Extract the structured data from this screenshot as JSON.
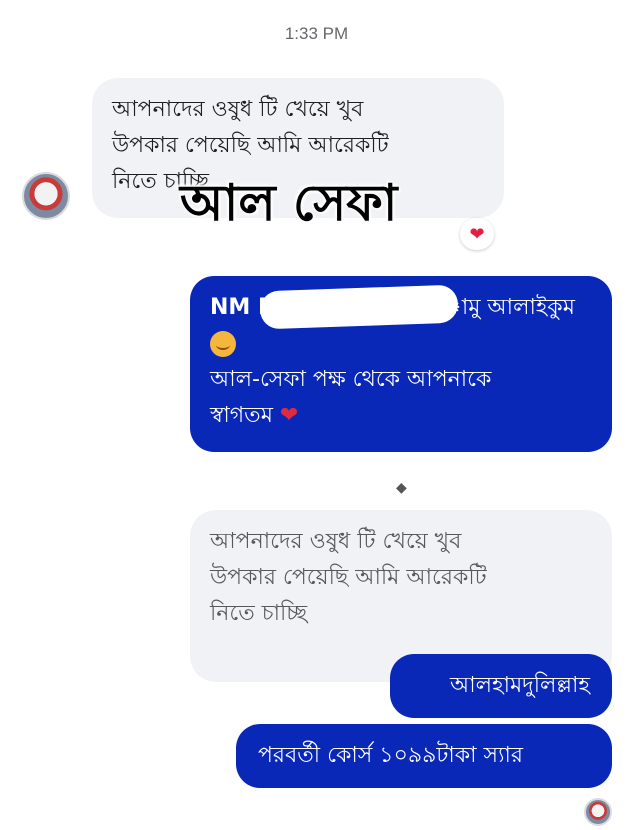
{
  "header": {
    "timestamp": "1:33 PM"
  },
  "messages": {
    "incoming_1": {
      "lines": [
        "আপনাদের ওষুধ টি খেয়ে খুব",
        "উপকার পেয়েছি  আমি আরেকটি",
        "নিতে চাচ্ছি"
      ]
    },
    "outgoing_1": {
      "line1_name": "NM Na",
      "line1_greeting": "ামু আলাইকুম",
      "line3": "আল-সেফা পক্ষ থেকে আপনাকে",
      "line4": "স্বাগতম",
      "heart": "❤"
    },
    "incoming_2": {
      "lines": [
        "আপনাদের ওষুধ টি খেয়ে খুব",
        "উপকার পেয়েছি  আমি আরেকটি",
        "নিতে চাচ্ছি"
      ]
    },
    "outgoing_2": {
      "text": "আলহামদুলিল্লাহ"
    },
    "outgoing_3": {
      "text": "পরবর্তী কোর্স ১০৯৯টাকা স্যার"
    }
  },
  "watermark": {
    "text": "আল সেফা"
  },
  "reaction": {
    "emoji": "❤"
  },
  "icons": {
    "avatar": "avatar-icon",
    "reaction": "heart-icon",
    "emoji": "smiling-face-with-hearts-icon"
  },
  "colors": {
    "outgoing_bubble": "#0a28b8",
    "incoming_bubble": "#f0f2f5",
    "timestamp": "#65676b"
  }
}
